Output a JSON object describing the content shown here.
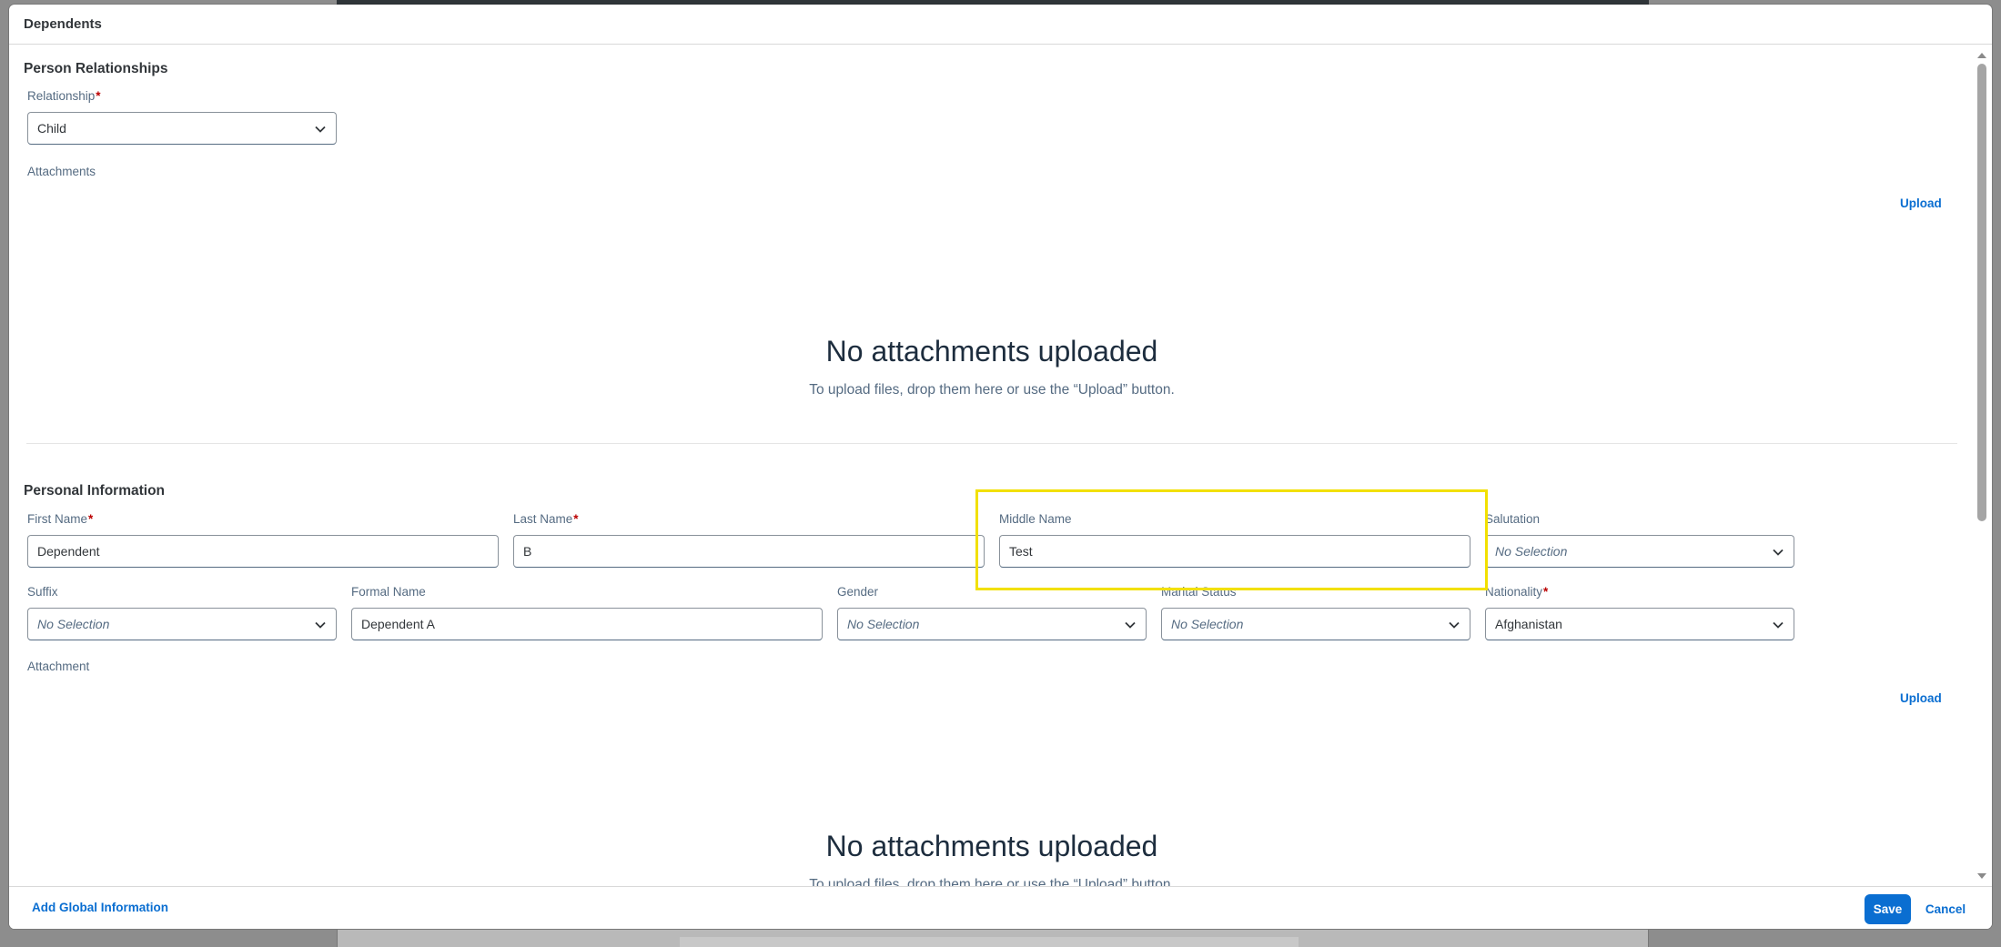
{
  "dialog": {
    "title": "Dependents"
  },
  "person_relationships": {
    "section_title": "Person Relationships",
    "relationship": {
      "label": "Relationship",
      "value": "Child"
    },
    "attachments_label": "Attachments",
    "upload_label": "Upload",
    "empty_title": "No attachments uploaded",
    "empty_subtitle": "To upload files, drop them here or use the “Upload” button."
  },
  "personal_information": {
    "section_title": "Personal Information",
    "first_name": {
      "label": "First Name",
      "value": "Dependent"
    },
    "last_name": {
      "label": "Last Name",
      "value": "B"
    },
    "middle_name": {
      "label": "Middle Name",
      "value": "Test"
    },
    "salutation": {
      "label": "Salutation",
      "value": "No Selection"
    },
    "suffix": {
      "label": "Suffix",
      "value": "No Selection"
    },
    "formal_name": {
      "label": "Formal Name",
      "value": "Dependent A"
    },
    "gender": {
      "label": "Gender",
      "value": "No Selection"
    },
    "marital_status": {
      "label": "Marital Status",
      "value": "No Selection"
    },
    "nationality": {
      "label": "Nationality",
      "value": "Afghanistan"
    },
    "attachment_label": "Attachment",
    "upload_label": "Upload",
    "empty_title": "No attachments uploaded",
    "empty_subtitle": "To upload files, drop them here or use the “Upload” button."
  },
  "footer": {
    "add_global_label": "Add Global Information",
    "save_label": "Save",
    "cancel_label": "Cancel"
  },
  "colors": {
    "accent": "#0a6ed1",
    "required": "#bb0000",
    "highlight": "#f2e000"
  },
  "icons": {
    "dropdown": "chevron-down-icon"
  }
}
